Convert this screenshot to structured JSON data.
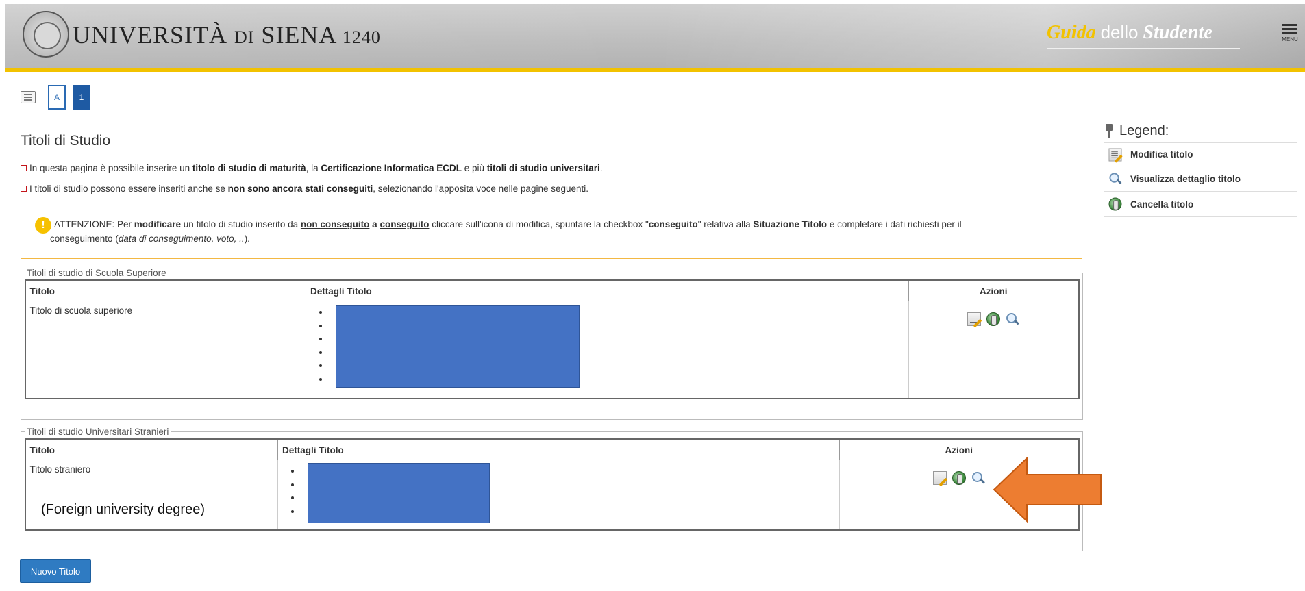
{
  "header": {
    "university_name": "UNIVERSITÀ",
    "university_di": "DI",
    "university_city": "SIENA",
    "university_year": "1240",
    "guide_part1": "Guida",
    "guide_part2": "dello",
    "guide_part3": "Studente",
    "menu_label": "MENU",
    "colors": {
      "header_bg": "#bdbdbd",
      "accent_bar": "#f2c200",
      "guide_highlight": "#f2c200"
    }
  },
  "steps": {
    "a_label": "A",
    "one_label": "1"
  },
  "page": {
    "title": "Titoli di Studio",
    "intro1": {
      "t1": "In questa pagina è possibile inserire un ",
      "b1": "titolo di studio di maturità",
      "t2": ", la ",
      "b2": "Certificazione Informatica ECDL",
      "t3": " e più ",
      "b3": "titoli di studio universitari",
      "t4": "."
    },
    "intro2": {
      "t1": "I titoli di studio possono essere inseriti anche se ",
      "b1": "non sono ancora stati conseguiti",
      "t2": ", selezionando l'apposita voce nelle pagine seguenti."
    }
  },
  "alert": {
    "icon": "!",
    "t1": "ATTENZIONE: Per ",
    "b1": "modificare",
    "t2": " un titolo di studio inserito da ",
    "u1": "non conseguito",
    "t3": " ",
    "b2": "a",
    "t4": " ",
    "u2": "conseguito",
    "t5": " cliccare sull'icona di modifica, spuntare la checkbox \"",
    "b3": "conseguito",
    "t6": "\" relativa alla ",
    "b4": "Situazione Titolo",
    "t7": " e completare i dati richiesti per il",
    "t8": "conseguimento (",
    "i1": "data di conseguimento, voto, ..",
    "t9": ")."
  },
  "section_school": {
    "legend": "Titoli di studio di Scuola Superiore",
    "columns": [
      "Titolo",
      "Dettagli Titolo",
      "Azioni"
    ],
    "row_title": "Titolo di scuola superiore"
  },
  "section_foreign": {
    "legend": "Titoli di studio Universitari Stranieri",
    "columns": [
      "Titolo",
      "Dettagli Titolo",
      "Azioni"
    ],
    "row_title": "Titolo straniero",
    "annotation": "(Foreign university degree)"
  },
  "buttons": {
    "new_title": "Nuovo Titolo"
  },
  "legend": {
    "title": "Legend:",
    "items": [
      {
        "icon": "edit-icon",
        "label": "Modifica titolo"
      },
      {
        "icon": "magnifier-icon",
        "label": "Visualizza dettaglio titolo"
      },
      {
        "icon": "delete-globe-icon",
        "label": "Cancella titolo"
      }
    ]
  },
  "annotation_arrow_color": "#ed7d31",
  "redaction_color": "#4472c4"
}
